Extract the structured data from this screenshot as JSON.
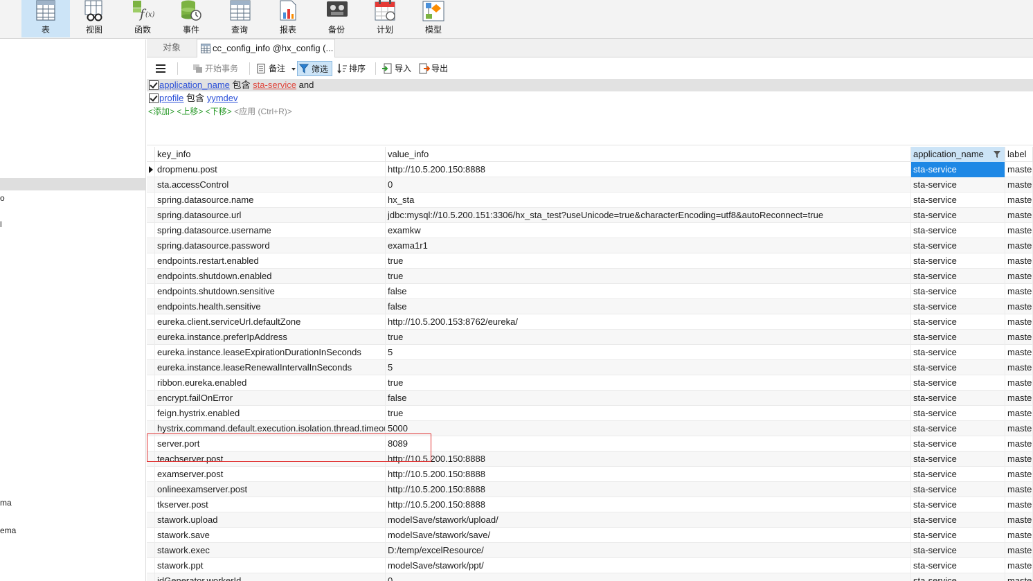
{
  "ribbon": {
    "items": [
      {
        "label": "表",
        "icon": "table-icon"
      },
      {
        "label": "视图",
        "icon": "view-icon"
      },
      {
        "label": "函数",
        "icon": "function-icon"
      },
      {
        "label": "事件",
        "icon": "event-icon"
      },
      {
        "label": "查询",
        "icon": "query-icon"
      },
      {
        "label": "报表",
        "icon": "report-icon"
      },
      {
        "label": "备份",
        "icon": "backup-icon"
      },
      {
        "label": "计划",
        "icon": "schedule-icon"
      },
      {
        "label": "模型",
        "icon": "model-icon"
      }
    ]
  },
  "left_panel": {
    "fragments": [
      "o",
      "l",
      "ma",
      "ema"
    ]
  },
  "tabs": {
    "objects": "对象",
    "table": "cc_config_info @hx_config (..."
  },
  "toolbar": {
    "menu_icon": "hamburger-menu-icon",
    "begin_transaction": "开始事务",
    "memo": "备注",
    "filter": "筛选",
    "sort": "排序",
    "import": "导入",
    "export": "导出"
  },
  "filter": {
    "rules": [
      {
        "field": "application_name",
        "op": "包含",
        "value": "sta-service",
        "joiner": "and"
      },
      {
        "field": "profile",
        "op": "包含",
        "value": "yymdev",
        "joiner": ""
      }
    ],
    "actions": {
      "add": "<添加>",
      "move_up": "<上移>",
      "move_down": "<下移>",
      "apply": "<应用 (Ctrl+R)>"
    }
  },
  "grid": {
    "columns": [
      "key_info",
      "value_info",
      "application_name",
      "label"
    ],
    "rows": [
      [
        "dropmenu.post",
        "http://10.5.200.150:8888",
        "sta-service",
        "master"
      ],
      [
        "sta.accessControl",
        "0",
        "sta-service",
        "master"
      ],
      [
        "spring.datasource.name",
        "hx_sta",
        "sta-service",
        "master"
      ],
      [
        "spring.datasource.url",
        "jdbc:mysql://10.5.200.151:3306/hx_sta_test?useUnicode=true&characterEncoding=utf8&autoReconnect=true",
        "sta-service",
        "master"
      ],
      [
        "spring.datasource.username",
        "examkw",
        "sta-service",
        "master"
      ],
      [
        "spring.datasource.password",
        "exama1r1",
        "sta-service",
        "master"
      ],
      [
        "endpoints.restart.enabled",
        "true",
        "sta-service",
        "master"
      ],
      [
        "endpoints.shutdown.enabled",
        "true",
        "sta-service",
        "master"
      ],
      [
        "endpoints.shutdown.sensitive",
        "false",
        "sta-service",
        "master"
      ],
      [
        "endpoints.health.sensitive",
        "false",
        "sta-service",
        "master"
      ],
      [
        "eureka.client.serviceUrl.defaultZone",
        "http://10.5.200.153:8762/eureka/",
        "sta-service",
        "master"
      ],
      [
        "eureka.instance.preferIpAddress",
        "true",
        "sta-service",
        "master"
      ],
      [
        "eureka.instance.leaseExpirationDurationInSeconds",
        "5",
        "sta-service",
        "master"
      ],
      [
        "eureka.instance.leaseRenewalIntervalInSeconds",
        "5",
        "sta-service",
        "master"
      ],
      [
        "ribbon.eureka.enabled",
        "true",
        "sta-service",
        "master"
      ],
      [
        "encrypt.failOnError",
        "false",
        "sta-service",
        "master"
      ],
      [
        "feign.hystrix.enabled",
        "true",
        "sta-service",
        "master"
      ],
      [
        "hystrix.command.default.execution.isolation.thread.timeoutInMilliseconds",
        "5000",
        "sta-service",
        "master"
      ],
      [
        "server.port",
        "8089",
        "sta-service",
        "master"
      ],
      [
        "teachserver.post",
        "http://10.5.200.150:8888",
        "sta-service",
        "master"
      ],
      [
        "examserver.post",
        "http://10.5.200.150:8888",
        "sta-service",
        "master"
      ],
      [
        "onlineexamserver.post",
        "http://10.5.200.150:8888",
        "sta-service",
        "master"
      ],
      [
        "tkserver.post",
        "http://10.5.200.150:8888",
        "sta-service",
        "master"
      ],
      [
        "stawork.upload",
        "modelSave/stawork/upload/",
        "sta-service",
        "master"
      ],
      [
        "stawork.save",
        "modelSave/stawork/save/",
        "sta-service",
        "master"
      ],
      [
        "stawork.exec",
        "D:/temp/excelResource/",
        "sta-service",
        "master"
      ],
      [
        "stawork.ppt",
        "modelSave/stawork/ppt/",
        "sta-service",
        "master"
      ],
      [
        "idGenerator.workerId",
        "0",
        "sta-service",
        "master"
      ]
    ]
  },
  "colors": {
    "selection": "#1e88e5",
    "ribbon_active": "#cce4f7",
    "filter_field": "#2a4fd8",
    "filter_value": "#e0463c",
    "filter_action": "#2a9a2a",
    "annotation": "#e03030"
  }
}
